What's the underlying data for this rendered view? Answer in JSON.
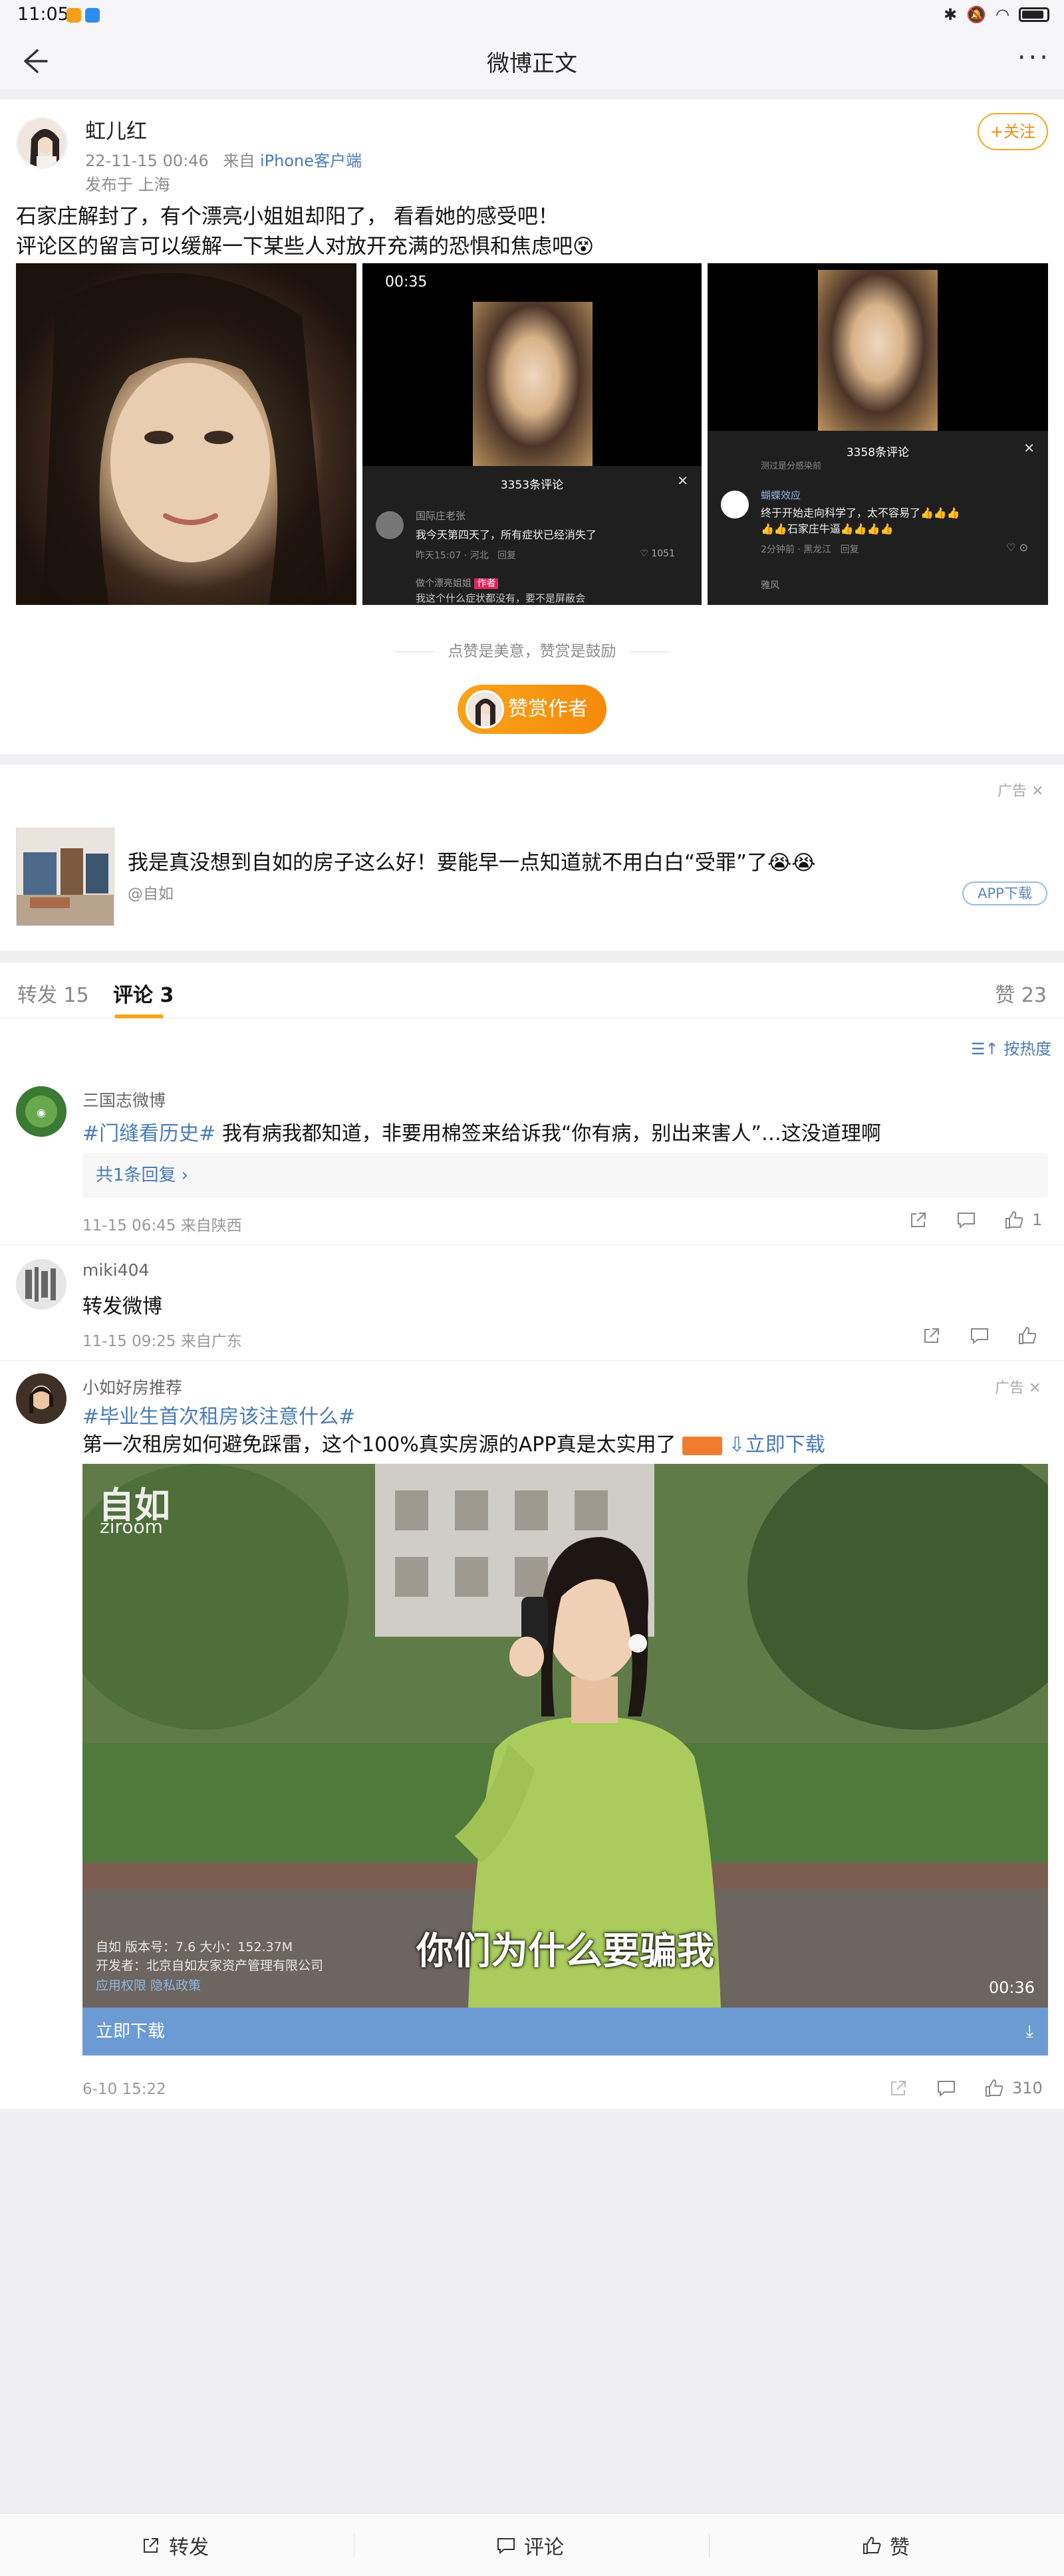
{
  "status_bar": {
    "time": "11:05"
  },
  "nav": {
    "title": "微博正文"
  },
  "post": {
    "username": "虹儿红",
    "date": "22-11-15 00:46",
    "source_prefix": "来自",
    "source": "iPhone客户端",
    "location": "发布于 上海",
    "follow_label": "+关注",
    "text_line1": "石家庄解封了，有个漂亮小姐姐却阳了， 看看她的感受吧！",
    "text_line2": "评论区的留言可以缓解一下某些人对放开充满的恐惧和焦虑吧😵",
    "img2": {
      "time": "00:35",
      "comments_count": "3353条评论",
      "comment_user": "国际庄老张",
      "comment_text": "我今天第四天了，所有症状已经消失了",
      "comment_meta": "昨天15:07 · 河北",
      "reply": "回复",
      "likes": "1051",
      "next_user": "做个漂亮姐姐",
      "author_tag": "作者",
      "next_text": "我这个什么症状都没有，要不是屏蔽会"
    },
    "img3": {
      "comments_count": "3358条评论",
      "top_text": "测过是分感染前",
      "comment_user": "蝴蝶效应",
      "comment_text_1": "终于开始走向科学了，太不容易了👍👍👍",
      "comment_text_2": "👍👍石家庄牛逼👍👍👍👍",
      "comment_meta": "2分钟前 · 黑龙江",
      "reply": "回复",
      "next_user": "雅风"
    },
    "praise_text": "点赞是美意，赞赏是鼓励",
    "reward_label": "赞赏作者"
  },
  "ad": {
    "tag": "广告",
    "text": "我是真没想到自如的房子这么好！要能早一点知道就不用白白“受罪”了😭😭",
    "sub": "@自如",
    "download": "APP下载"
  },
  "tabs": {
    "repost": "转发 15",
    "comment": "评论 3",
    "like": "赞 23"
  },
  "sort_label": "按热度",
  "comments": [
    {
      "name": "三国志微博",
      "tag": "#门缝看历史#",
      "text": " 我有病我都知道，非要用棉签来给诉我“你有病，别出来害人”…这没道理啊",
      "reply_box": "共1条回复 ›",
      "meta": "11-15 06:45  来自陕西",
      "likes": "1"
    },
    {
      "name": "miki404",
      "text": "转发微博",
      "meta": "11-15 09:25  来自广东",
      "likes": ""
    },
    {
      "name": "小如好房推荐",
      "ad_tag": "广告",
      "tag": "#毕业生首次租房该注意什么#",
      "text": "第一次租房如何避免踩雷，这个100%真实房源的APP真是太实用了",
      "link": "⇩立即下载",
      "video": {
        "logo": "自如",
        "logo_sub": "ziroom",
        "subtitle": "你们为什么要骗我",
        "app_info_1": "自如  版本号：7.6  大小：152.37M",
        "app_info_2": "开发者：北京自如友家资产管理有限公司",
        "app_info_3": "应用权限    隐私政策",
        "duration": "00:36"
      },
      "download_bar": "立即下载",
      "meta": "6-10 15:22",
      "likes": "310"
    }
  ],
  "bottom_bar": {
    "repost": "转发",
    "comment": "评论",
    "like": "赞"
  }
}
